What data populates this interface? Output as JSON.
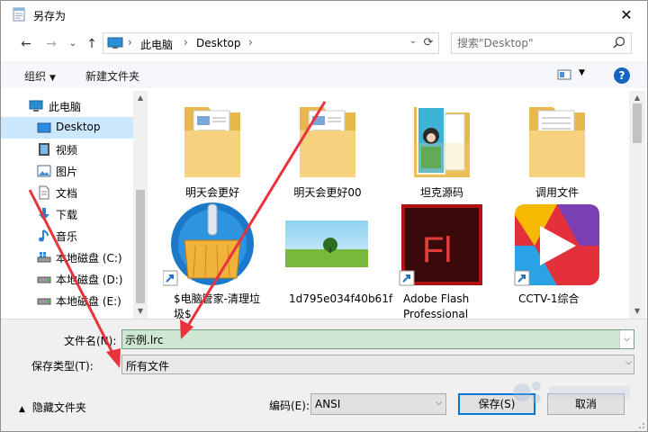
{
  "window": {
    "title": "另存为"
  },
  "address": {
    "segments": [
      "此电脑",
      "Desktop"
    ],
    "search_placeholder": "搜索\"Desktop\""
  },
  "toolbar": {
    "organize_label": "组织",
    "new_folder_label": "新建文件夹",
    "help_label": "?"
  },
  "sidebar": {
    "items": [
      {
        "label": "此电脑",
        "icon": "pc-icon"
      },
      {
        "label": "Desktop",
        "icon": "desktop-icon",
        "selected": true
      },
      {
        "label": "视频",
        "icon": "video-icon"
      },
      {
        "label": "图片",
        "icon": "pictures-icon"
      },
      {
        "label": "文档",
        "icon": "documents-icon"
      },
      {
        "label": "下载",
        "icon": "download-icon"
      },
      {
        "label": "音乐",
        "icon": "music-icon"
      },
      {
        "label": "本地磁盘 (C:)",
        "icon": "drive-icon"
      },
      {
        "label": "本地磁盘 (D:)",
        "icon": "drive-icon"
      },
      {
        "label": "本地磁盘 (E:)",
        "icon": "drive-icon"
      }
    ]
  },
  "files": [
    {
      "name": "明天会更好",
      "kind": "folder"
    },
    {
      "name": "明天会更好00",
      "kind": "folder"
    },
    {
      "name": "坦克源码",
      "kind": "folder-image"
    },
    {
      "name": "调用文件",
      "kind": "folder"
    },
    {
      "name": "$电脑管家-清理垃圾$",
      "kind": "broom-shortcut"
    },
    {
      "name": "1d795e034f40b61f",
      "kind": "landscape-image"
    },
    {
      "name": "Adobe Flash Professional",
      "kind": "flash-shortcut"
    },
    {
      "name": "CCTV-1综合",
      "kind": "cctv-shortcut"
    }
  ],
  "bottom": {
    "filename_label": "文件名(N):",
    "filename_value": "示例.lrc",
    "filetype_label": "保存类型(T):",
    "filetype_value": "所有文件",
    "hide_folders_label": "隐藏文件夹",
    "encoding_label": "编码(E):",
    "encoding_value": "ANSI",
    "save_label": "保存(S)",
    "cancel_label": "取消"
  },
  "colors": {
    "selection": "#cce8ff",
    "filename_bg": "#cde7d2",
    "annotation_arrow": "#e8333a",
    "primary_button_border": "#0078d7"
  }
}
